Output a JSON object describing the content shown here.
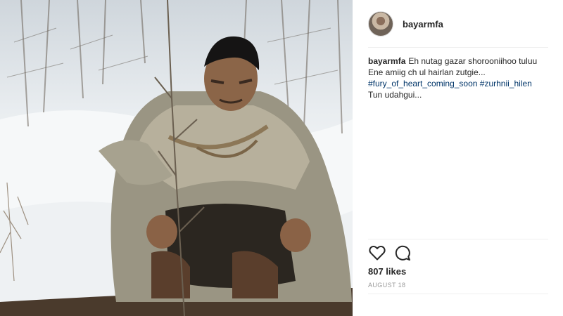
{
  "post": {
    "username": "bayarmfa",
    "caption": {
      "username": "bayarmfa",
      "lines": [
        "Eh nutag gazar shorooniihoo tuluu",
        "Ene amiig ch ul hairlan zutgie..."
      ],
      "hashtags": [
        "#fury_of_heart_coming_soon",
        "#zurhnii_hilen"
      ],
      "closing_line": "Tun udahgui..."
    },
    "likes": "807 likes",
    "date": "AUGUST 18"
  },
  "icons": {
    "like": "heart-icon",
    "comment": "comment-icon"
  },
  "colors": {
    "hashtag": "#003569",
    "divider": "#efefef",
    "text": "#262626",
    "muted": "#999999"
  }
}
